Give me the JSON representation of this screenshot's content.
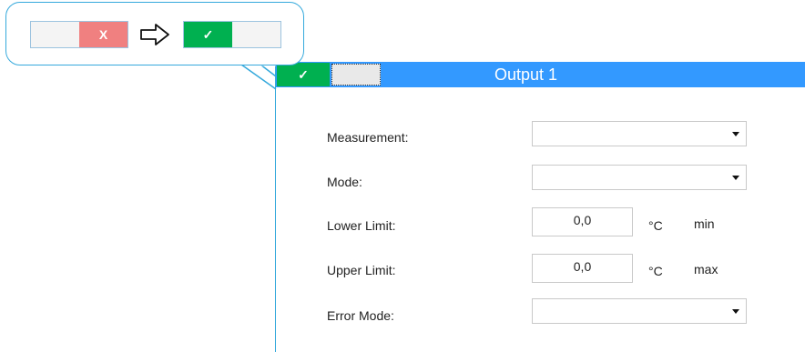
{
  "callout": {
    "toggle_off": {
      "left_label": "",
      "right_label": "X"
    },
    "arrow_icon": "right-arrow-outline-icon",
    "toggle_on": {
      "left_label": "✓",
      "right_label": ""
    }
  },
  "panel": {
    "title": "Output 1",
    "toggle": {
      "on_label": "✓",
      "off_label": ""
    },
    "fields": {
      "measurement": {
        "label": "Measurement:",
        "value": ""
      },
      "mode": {
        "label": "Mode:",
        "value": ""
      },
      "lower_limit": {
        "label": "Lower Limit:",
        "value": "0,0",
        "unit": "°C",
        "suffix": "min"
      },
      "upper_limit": {
        "label": "Upper Limit:",
        "value": "0,0",
        "unit": "°C",
        "suffix": "max"
      },
      "error_mode": {
        "label": "Error Mode:",
        "value": ""
      }
    }
  },
  "colors": {
    "header_blue": "#3399ff",
    "toggle_green": "#00b050",
    "toggle_red": "#f08080",
    "callout_border": "#35a9dc"
  }
}
